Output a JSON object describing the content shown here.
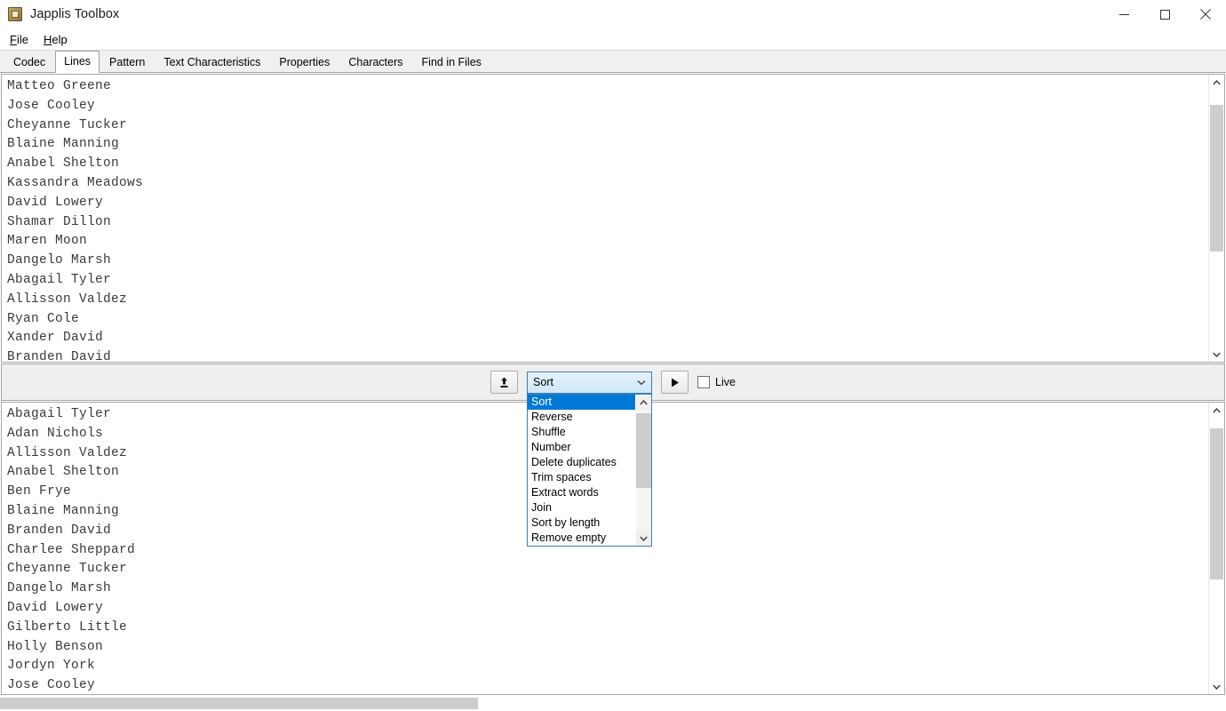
{
  "window": {
    "title": "Japplis Toolbox",
    "icon": "toolbox-icon",
    "minimize": "–",
    "maximize": "□",
    "close": "✕"
  },
  "menubar": {
    "items": [
      {
        "label": "File",
        "mnemonic": "F"
      },
      {
        "label": "Help",
        "mnemonic": "H"
      }
    ]
  },
  "tabs": {
    "active": "Lines",
    "items": [
      {
        "label": "Codec"
      },
      {
        "label": "Lines"
      },
      {
        "label": "Pattern"
      },
      {
        "label": "Text Characteristics"
      },
      {
        "label": "Properties"
      },
      {
        "label": "Characters"
      },
      {
        "label": "Find in Files"
      }
    ]
  },
  "input_pane": {
    "lines": [
      "Matteo Greene",
      "Jose Cooley",
      "Cheyanne Tucker",
      "Blaine Manning",
      "Anabel Shelton",
      "Kassandra Meadows",
      "David Lowery",
      "Shamar Dillon",
      "Maren Moon",
      "Dangelo Marsh",
      "Abagail Tyler",
      "Allisson Valdez",
      "Ryan Cole",
      "Xander David",
      "Branden David"
    ],
    "scroll": {
      "thumb_top_pct": 6,
      "thumb_height_pct": 57
    }
  },
  "toolbar": {
    "upload_button": "upload-icon",
    "run_button": "play-icon",
    "combo": {
      "selected": "Sort",
      "arrow": "chevron-down-icon",
      "expanded": true
    },
    "live_checkbox": {
      "label": "Live",
      "checked": false
    }
  },
  "dropdown": {
    "selected_index": 0,
    "options": [
      "Sort",
      "Reverse",
      "Shuffle",
      "Number",
      "Delete duplicates",
      "Trim spaces",
      "Extract words",
      "Join",
      "Sort by length",
      "Remove empty"
    ],
    "scroll": {
      "thumb_top_pct": 3,
      "thumb_height_pct": 62
    }
  },
  "output_pane": {
    "lines": [
      "Abagail Tyler",
      "Adan Nichols",
      "Allisson Valdez",
      "Anabel Shelton",
      "Ben Frye",
      "Blaine Manning",
      "Branden David",
      "Charlee Sheppard",
      "Cheyanne Tucker",
      "Dangelo Marsh",
      "David Lowery",
      "Gilberto Little",
      "Holly Benson",
      "Jordyn York",
      "Jose Cooley"
    ],
    "scroll": {
      "thumb_top_pct": 4,
      "thumb_height_pct": 58
    },
    "hscroll": {
      "thumb_left_pct": 0,
      "thumb_width_pct": 39
    }
  },
  "colors": {
    "accent": "#0078d7",
    "combo_border": "#3c7fb1",
    "toolbar_bg": "#efefef",
    "pane_border": "#a7a7a7",
    "scrollbar_thumb": "#cdcdcd",
    "text": "#3a3a3a"
  }
}
